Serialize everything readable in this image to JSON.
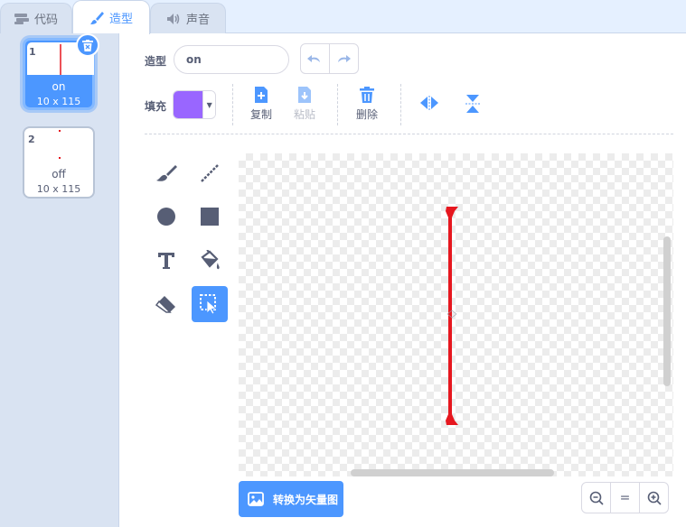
{
  "tabs": [
    {
      "label": "代码",
      "icon": "code-blocks-icon"
    },
    {
      "label": "造型",
      "icon": "paintbrush-icon"
    },
    {
      "label": "声音",
      "icon": "speaker-icon"
    }
  ],
  "costumes": [
    {
      "number": "1",
      "name": "on",
      "size": "10 x 115"
    },
    {
      "number": "2",
      "name": "off",
      "size": "10 x 115"
    }
  ],
  "editor": {
    "costume_label": "造型",
    "costume_name": "on",
    "fill_label": "填充",
    "fill_color": "#9966ff",
    "copy_label": "复制",
    "paste_label": "粘贴",
    "delete_label": "删除",
    "convert_label": "转换为矢量图",
    "zoom_reset": "="
  },
  "colors": {
    "accent": "#4c97ff",
    "line": "#e6171f"
  }
}
